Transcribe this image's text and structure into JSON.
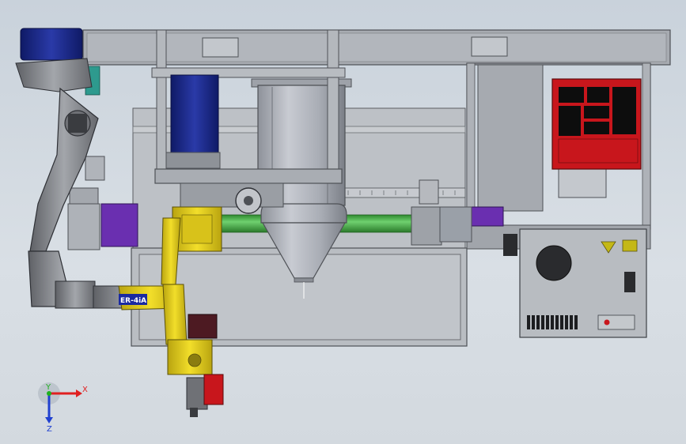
{
  "viewport": {
    "triad": {
      "x_label": "X",
      "y_label": "Y",
      "z_label": "Z",
      "x_color": "#e02020",
      "y_color": "#20b020",
      "z_color": "#2040d0"
    }
  },
  "robot": {
    "arm_label": "ER-4iA",
    "arm_color": "#e9d41c",
    "large_robot_color": "#7d7f83"
  },
  "colors": {
    "frame": "#a9adb3",
    "motor_blue": "#1a2a8a",
    "cabinet_red": "#c8161c",
    "tube_green": "#4cb04c",
    "purple_block": "#6a2fb0",
    "teal_block": "#2e9a8e"
  }
}
